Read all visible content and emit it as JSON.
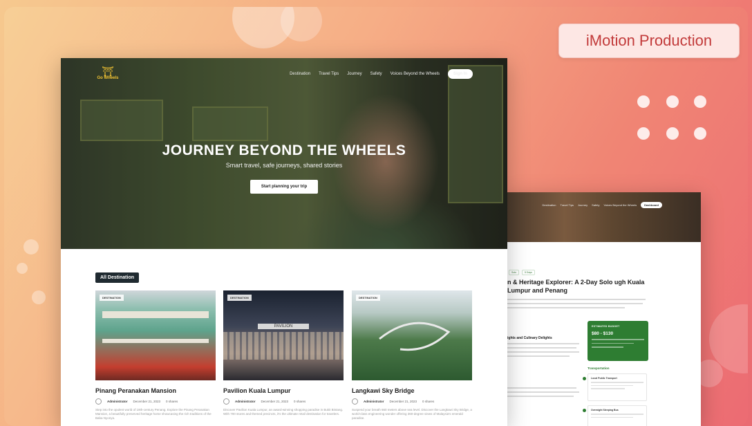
{
  "badge": {
    "label": "iMotion Production"
  },
  "site": {
    "logo_text": "Go Wheels",
    "nav": [
      "Destination",
      "Travel Tips",
      "Journey",
      "Safety",
      "Voices Beyond the Wheels"
    ],
    "signin": "Sign In",
    "hero_title": "JOURNEY BEYOND THE WHEELS",
    "hero_subtitle": "Smart travel, safe journeys, shared stories",
    "cta": "Start planning your trip",
    "section_tag": "All Destination",
    "cards": [
      {
        "tag": "DESTINATION",
        "title": "Pinang Peranakan Mansion",
        "author": "Administrator",
        "date": "December 21, 2023",
        "shares": "0 shares",
        "desc": "Step into the opulent world of 19th-century Penang. Explore the Pinang Peranakan Mansion, a beautifully preserved heritage home showcasing the rich traditions of the Baba Nyonya."
      },
      {
        "tag": "DESTINATION",
        "title": "Pavilion Kuala Lumpur",
        "author": "Administrator",
        "date": "December 21, 2023",
        "shares": "0 shares",
        "desc": "Discover Pavilion Kuala Lumpur, an award-winning shopping paradise in Bukit Bintang. With 700 stores and themed precincts, it's the ultimate retail destination for travelers."
      },
      {
        "tag": "DESTINATION",
        "title": "Langkawi Sky Bridge",
        "author": "Administrator",
        "date": "December 21, 2023",
        "shares": "0 shares",
        "desc": "Suspend your breath 660 meters above sea level. Discover the Langkawi Sky Bridge, a world-class engineering wonder offering 360-degree views of Malaysia's emerald paradise."
      }
    ]
  },
  "side": {
    "nav": [
      "Destination",
      "Travel Tips",
      "Journey",
      "Safety",
      "Voices Beyond the Wheels"
    ],
    "dashboard": "Dashboard",
    "pills": [
      "Solo",
      "5 Days"
    ],
    "title": "n & Heritage Explorer: A 2-Day Solo ugh Kuala Lumpur and Penang",
    "h2": "ights and Culinary Delights",
    "budget_label": "ESTIMATED BUDGET",
    "budget_value": "$80 - $130",
    "transport_heading": "Transportation",
    "transport": [
      "Local Public Transport",
      "Overnight Sleeping Bus"
    ]
  }
}
